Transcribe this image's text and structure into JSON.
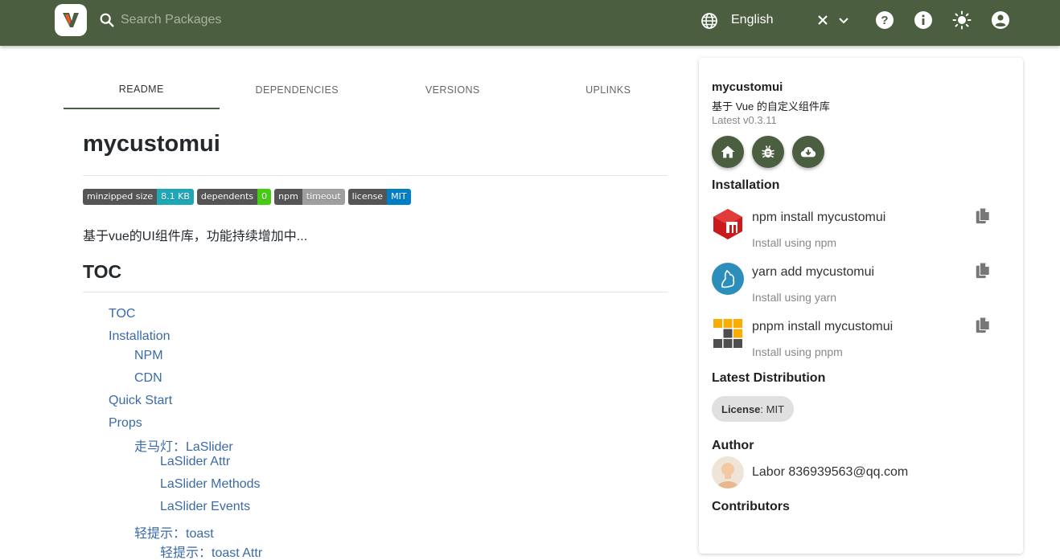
{
  "header": {
    "search_placeholder": "Search Packages",
    "language": "English",
    "accent_color": "#4b5e40"
  },
  "tabs": [
    {
      "label": "README",
      "active": true
    },
    {
      "label": "DEPENDENCIES",
      "active": false
    },
    {
      "label": "VERSIONS",
      "active": false
    },
    {
      "label": "UPLINKS",
      "active": false
    }
  ],
  "readme": {
    "title": "mycustomui",
    "badges": [
      {
        "label": "minzipped size",
        "value": "8.1 KB",
        "color": "#1fa7b8"
      },
      {
        "label": "dependents",
        "value": "0",
        "color": "#44cc11"
      },
      {
        "label": "npm",
        "value": "timeout",
        "color": "#9f9f9f"
      },
      {
        "label": "license",
        "value": "MIT",
        "color": "#007ec6"
      }
    ],
    "description": "基于vue的UI组件库，功能持续增加中...",
    "toc_heading": "TOC",
    "toc": [
      {
        "text": "TOC"
      },
      {
        "text": "Installation"
      },
      {
        "text": "NPM"
      },
      {
        "text": "CDN"
      },
      {
        "text": "Quick Start"
      },
      {
        "text": "Props"
      },
      {
        "text": "走马灯：LaSlider"
      },
      {
        "text": "LaSlider Attr"
      },
      {
        "text": "LaSlider Methods"
      },
      {
        "text": "LaSlider Events"
      },
      {
        "text": "轻提示：toast"
      },
      {
        "text": "轻提示：toast Attr"
      }
    ]
  },
  "sidebar": {
    "name": "mycustomui",
    "description": "基于 Vue 的自定义组件库",
    "latest": "Latest v0.3.11",
    "installation_title": "Installation",
    "installs": [
      {
        "command": "npm install mycustomui",
        "hint": "Install using npm",
        "icon": "npm-icon"
      },
      {
        "command": "yarn add mycustomui",
        "hint": "Install using yarn",
        "icon": "yarn-icon"
      },
      {
        "command": "pnpm install mycustomui",
        "hint": "Install using pnpm",
        "icon": "pnpm-icon"
      }
    ],
    "distribution_title": "Latest Distribution",
    "license_label": "License",
    "license_value": ": MIT",
    "author_title": "Author",
    "author": "Labor 836939563@qq.com",
    "contributors_title": "Contributors"
  }
}
